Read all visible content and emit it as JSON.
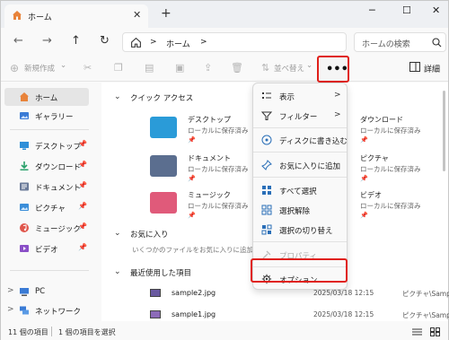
{
  "tab": {
    "title": "ホーム",
    "close": "✕",
    "new_tab": "+"
  },
  "window_controls": {
    "minimize": "─",
    "maximize": "☐",
    "close": "✕"
  },
  "nav": {
    "back": "←",
    "forward": "→",
    "up": "↑",
    "refresh": "↻"
  },
  "address": {
    "separator1": ">",
    "location": "ホーム",
    "separator2": ">"
  },
  "search": {
    "placeholder": "ホームの検索",
    "icon": "search-icon"
  },
  "command_bar": {
    "new_label": "新規作成",
    "new_chevron": "⌄",
    "sort_label": "並べ替え",
    "sort_chevron": "⌄",
    "more_label": "•••",
    "details_label": "詳細"
  },
  "sidebar": {
    "items": [
      {
        "label": "ホーム",
        "icon": "home-icon",
        "color": "#e8833a"
      },
      {
        "label": "ギャラリー",
        "icon": "gallery-icon",
        "color": "#3a7bd5"
      },
      {
        "label": "デスクトップ",
        "icon": "desktop-icon",
        "color": "#2f8fd8",
        "pin": "📌"
      },
      {
        "label": "ダウンロード",
        "icon": "download-icon",
        "color": "#2aa16b",
        "pin": "📌"
      },
      {
        "label": "ドキュメント",
        "icon": "document-icon",
        "color": "#6a7a99",
        "pin": "📌"
      },
      {
        "label": "ピクチャ",
        "icon": "pictures-icon",
        "color": "#3b8ed9",
        "pin": "📌"
      },
      {
        "label": "ミュージック",
        "icon": "music-icon",
        "color": "#e0564c",
        "pin": "📌"
      },
      {
        "label": "ビデオ",
        "icon": "video-icon",
        "color": "#8a4fc7",
        "pin": "📌"
      },
      {
        "label": "PC",
        "icon": "pc-icon",
        "color": "#3a7bd5",
        "chev": ">"
      },
      {
        "label": "ネットワーク",
        "icon": "network-icon",
        "color": "#3a7bd5",
        "chev": ">"
      }
    ]
  },
  "main": {
    "quick_access": "クイック アクセス",
    "folders": [
      {
        "name": "デスクトップ",
        "sub": "ローカルに保存済み",
        "color": "#2a9bd8"
      },
      {
        "name": "ドキュメント",
        "sub": "ローカルに保存済み",
        "color": "#5b6e8f"
      },
      {
        "name": "ミュージック",
        "sub": "ローカルに保存済み",
        "color": "#e05a7a"
      },
      {
        "name": "ダウンロード",
        "sub": "ローカルに保存済み",
        "color": "#2aa16b"
      },
      {
        "name": "ピクチャ",
        "sub": "ローカルに保存済み",
        "color": "#3b8ed9"
      },
      {
        "name": "ビデオ",
        "sub": "ローカルに保存済み",
        "color": "#8a4fc7"
      }
    ],
    "favorites": "お気に入り",
    "favorites_empty": "いくつかのファイルをお気に入りに追加すると、ここに表示されます。",
    "recent": "最近使用した項目",
    "recent_files": [
      {
        "name": "sample2.jpg",
        "date": "2025/03/18 12:15",
        "location": "ピクチャ\\Sample"
      },
      {
        "name": "sample1.jpg",
        "date": "2025/03/18 12:15",
        "location": "ピクチャ\\Sample"
      }
    ]
  },
  "menu": {
    "items": [
      {
        "label": "表示",
        "icon": "view-icon",
        "arrow": ">"
      },
      {
        "label": "フィルター",
        "icon": "filter-icon",
        "arrow": ">"
      },
      {
        "label": "ディスクに書き込む",
        "icon": "disc-burn-icon"
      },
      {
        "label": "お気に入りに追加",
        "icon": "pin-icon"
      },
      {
        "label": "すべて選択",
        "icon": "select-all-icon"
      },
      {
        "label": "選択解除",
        "icon": "select-none-icon"
      },
      {
        "label": "選択の切り替え",
        "icon": "invert-selection-icon"
      },
      {
        "label": "プロパティ",
        "icon": "properties-icon",
        "disabled": true
      },
      {
        "label": "オプション",
        "icon": "options-gear-icon"
      }
    ]
  },
  "status": {
    "count": "11 個の項目",
    "selected": "1 個の項目を選択"
  },
  "colors": {
    "highlight": "#e0201a",
    "accent": "#3a7bd5"
  }
}
